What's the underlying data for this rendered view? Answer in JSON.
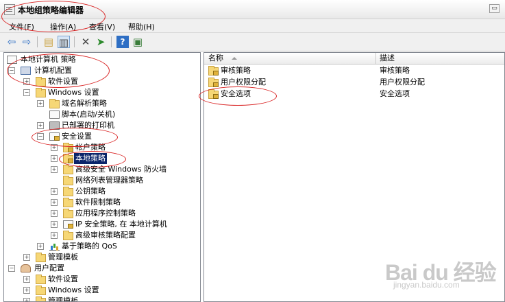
{
  "window": {
    "title": "本地组策略编辑器"
  },
  "menu": {
    "items": [
      "文件(F)",
      "操作(A)",
      "查看(V)",
      "帮助(H)"
    ]
  },
  "toolbar": {
    "icons": [
      "back-arrow-icon",
      "forward-arrow-icon",
      "up-folder-icon",
      "show-hide-tree-icon",
      "delete-icon",
      "export-list-icon",
      "help-icon",
      "properties-icon"
    ]
  },
  "tree": {
    "root": "本地计算机 策略",
    "computer_config": "计算机配置",
    "cc_software": "软件设置",
    "cc_windows": "Windows 设置",
    "dns": "域名解析策略",
    "scripts": "脚本(启动/关机)",
    "printers": "已部署的打印机",
    "security": "安全设置",
    "account_policy": "帐户策略",
    "local_policy": "本地策略",
    "firewall": "高级安全 Windows 防火墙",
    "netlist": "网络列表管理器策略",
    "pubkey": "公钥策略",
    "swrestrict": "软件限制策略",
    "appcontrol": "应用程序控制策略",
    "ipsec": "IP 安全策略, 在 本地计算机",
    "audit": "高级审核策略配置",
    "qos": "基于策略的 QoS",
    "cc_admin": "管理模板",
    "user_config": "用户配置",
    "uc_software": "软件设置",
    "uc_windows": "Windows 设置",
    "uc_admin": "管理模板"
  },
  "list": {
    "columns": {
      "name": "名称",
      "desc": "描述"
    },
    "rows": [
      {
        "name": "审核策略",
        "desc": "审核策略"
      },
      {
        "name": "用户权限分配",
        "desc": "用户权限分配"
      },
      {
        "name": "安全选项",
        "desc": "安全选项"
      }
    ]
  },
  "watermark": {
    "logo": "Bai du 经验",
    "url": "jingyan.baidu.com"
  },
  "colors": {
    "selection": "#0a246a",
    "annotation": "#d92424"
  }
}
